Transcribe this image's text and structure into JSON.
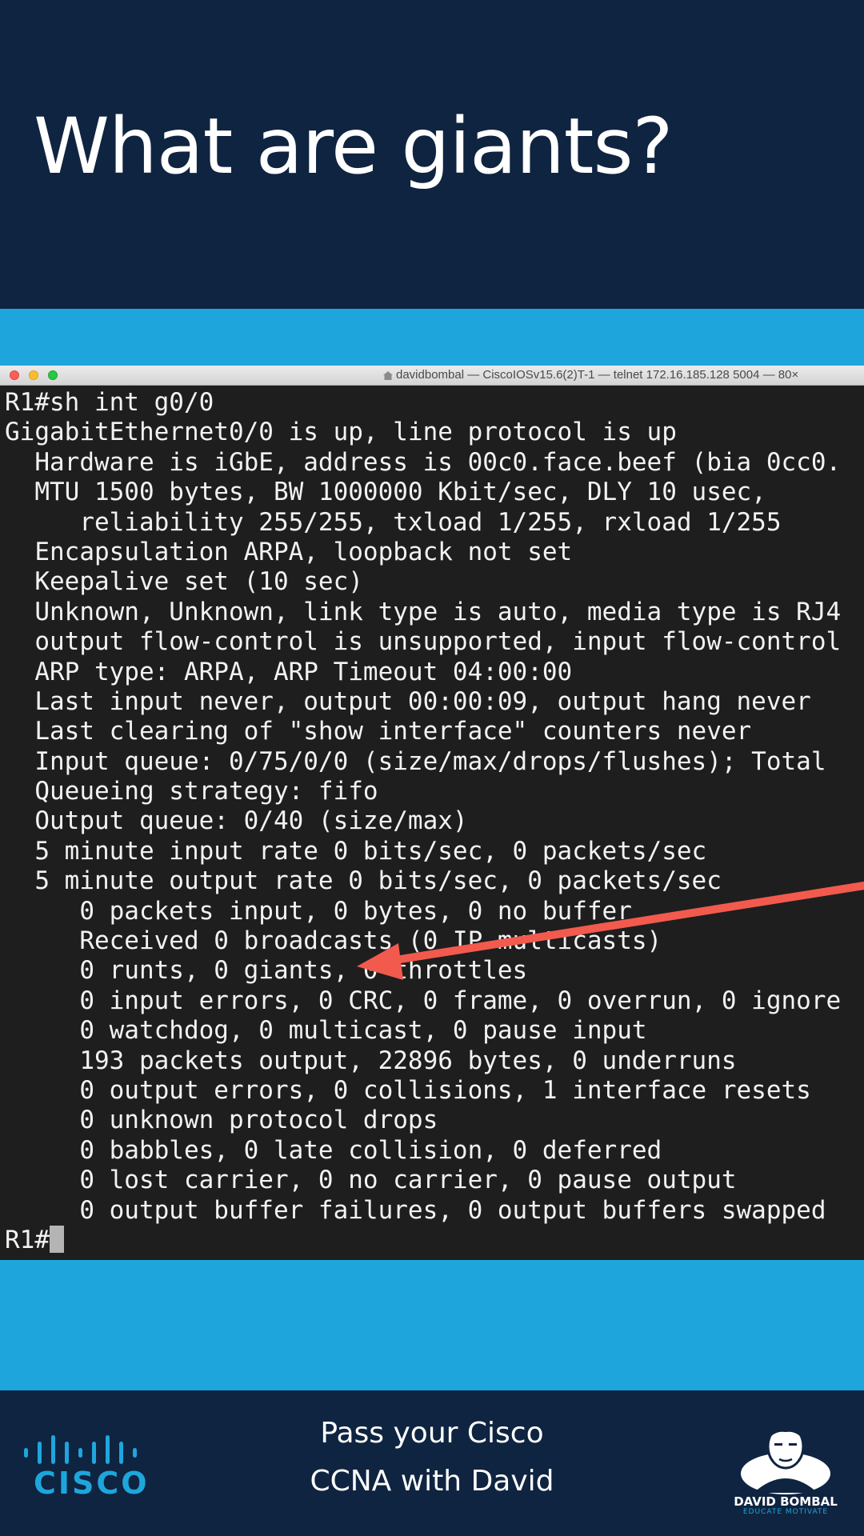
{
  "header": {
    "title": "What are giants?"
  },
  "terminal": {
    "window_title": "davidbombal — CiscoIOSv15.6(2)T-1 — telnet 172.16.185.128 5004 — 80×",
    "lines": [
      "R1#sh int g0/0",
      "GigabitEthernet0/0 is up, line protocol is up",
      "  Hardware is iGbE, address is 00c0.face.beef (bia 0cc0.",
      "  MTU 1500 bytes, BW 1000000 Kbit/sec, DLY 10 usec,",
      "     reliability 255/255, txload 1/255, rxload 1/255",
      "  Encapsulation ARPA, loopback not set",
      "  Keepalive set (10 sec)",
      "  Unknown, Unknown, link type is auto, media type is RJ4",
      "  output flow-control is unsupported, input flow-control",
      "  ARP type: ARPA, ARP Timeout 04:00:00",
      "  Last input never, output 00:00:09, output hang never",
      "  Last clearing of \"show interface\" counters never",
      "  Input queue: 0/75/0/0 (size/max/drops/flushes); Total",
      "  Queueing strategy: fifo",
      "  Output queue: 0/40 (size/max)",
      "  5 minute input rate 0 bits/sec, 0 packets/sec",
      "  5 minute output rate 0 bits/sec, 0 packets/sec",
      "     0 packets input, 0 bytes, 0 no buffer",
      "     Received 0 broadcasts (0 IP multicasts)",
      "     0 runts, 0 giants, 0 throttles",
      "     0 input errors, 0 CRC, 0 frame, 0 overrun, 0 ignore",
      "     0 watchdog, 0 multicast, 0 pause input",
      "     193 packets output, 22896 bytes, 0 underruns",
      "     0 output errors, 0 collisions, 1 interface resets",
      "     0 unknown protocol drops",
      "     0 babbles, 0 late collision, 0 deferred",
      "     0 lost carrier, 0 no carrier, 0 pause output",
      "     0 output buffer failures, 0 output buffers swapped"
    ],
    "prompt": "R1#",
    "annotation_color": "#f25a4d"
  },
  "footer": {
    "line1": "Pass your Cisco",
    "line2": "CCNA with David",
    "cisco_logo_text": "CISCO",
    "creator_name": "DAVID BOMBAL",
    "creator_tagline": "EDUCATE MOTIVATE",
    "accent_color": "#1ea6dc"
  }
}
